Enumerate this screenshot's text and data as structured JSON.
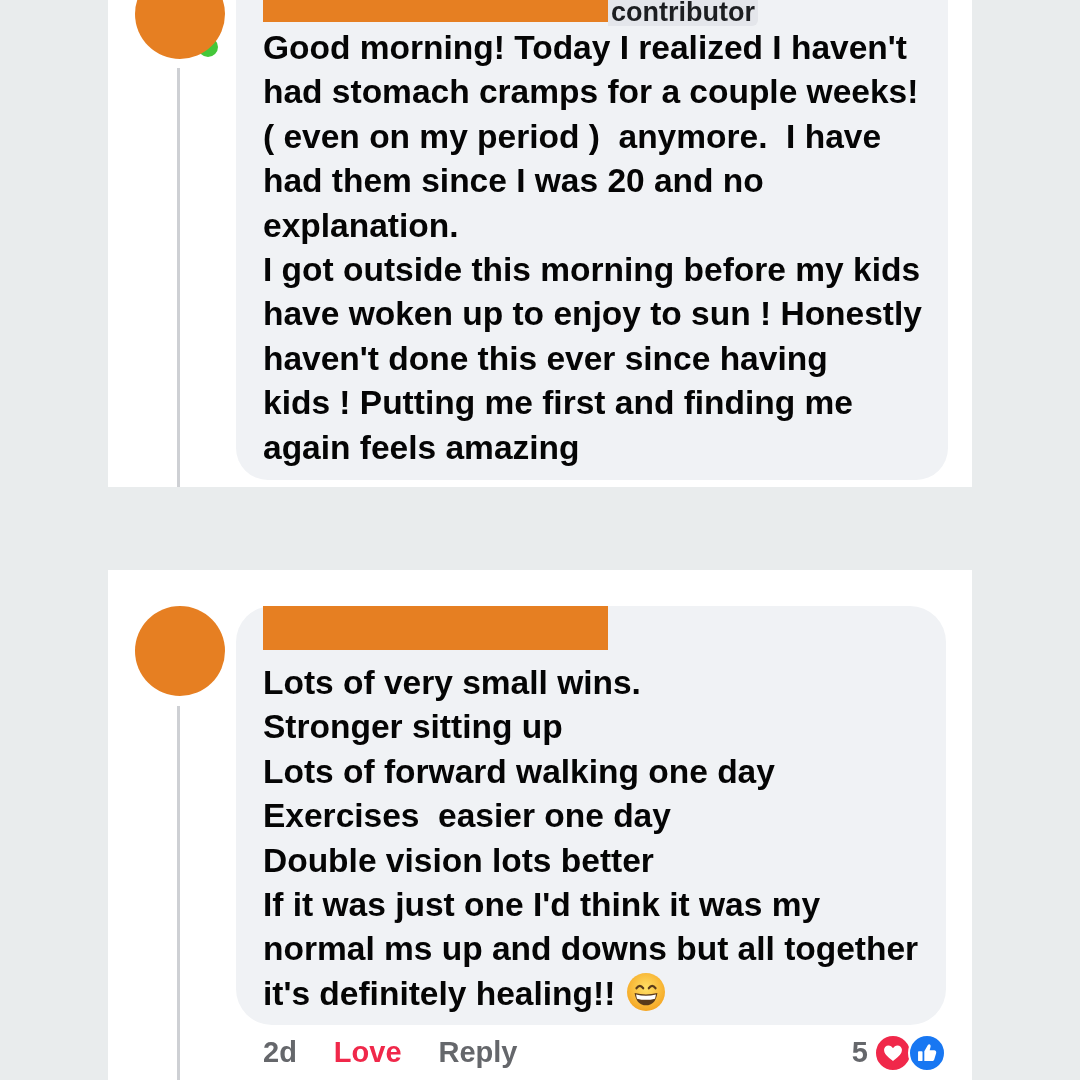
{
  "comments": [
    {
      "online": true,
      "badge": "contributor",
      "lines": [
        "Good morning! Today I realized I haven't",
        "had stomach cramps for a couple weeks!",
        "( even on my period )  anymore.  I have",
        "had them since I was 20 and no",
        "explanation.",
        "I got outside this morning before my kids",
        "have woken up to enjoy to sun ! Honestly",
        "haven't done this ever since having",
        "kids ! Putting me first and finding me",
        "again feels amazing"
      ]
    },
    {
      "online": false,
      "lines": [
        "Lots of very small wins.",
        "Stronger sitting up",
        "Lots of forward walking one day",
        "Exercises  easier one day",
        "Double vision lots better",
        "If it was just one I'd think it was my",
        "normal ms up and downs but all together",
        "it's definitely healing!!"
      ],
      "end_emoji": {
        "kind": "grin"
      },
      "footer": {
        "time": "2d",
        "reaction": {
          "label": "Love",
          "active": true
        },
        "reply": {
          "label": "Reply"
        },
        "reaction_count": "5",
        "reactions": [
          {
            "kind": "love"
          },
          {
            "kind": "like"
          }
        ]
      }
    }
  ]
}
